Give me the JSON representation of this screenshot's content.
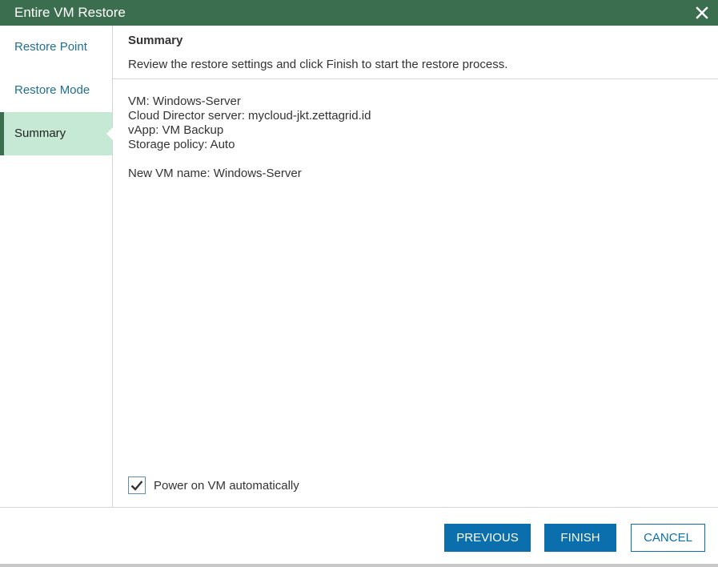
{
  "window": {
    "title": "Entire VM Restore",
    "close_icon": "close-icon"
  },
  "sidebar": {
    "items": [
      {
        "label": "Restore Point",
        "active": false
      },
      {
        "label": "Restore Mode",
        "active": false
      },
      {
        "label": "Summary",
        "active": true
      }
    ]
  },
  "main": {
    "title": "Summary",
    "description": "Review the restore settings and click Finish to start the restore process.",
    "details": {
      "vm": "VM: Windows-Server",
      "cloud_director": "Cloud Director server: mycloud-jkt.zettagrid.id",
      "vapp": "vApp: VM Backup",
      "storage_policy": "Storage policy: Auto",
      "new_vm_name": "New VM name: Windows-Server"
    },
    "power_on": {
      "label": "Power on VM automatically",
      "checked": true
    }
  },
  "footer": {
    "previous_label": "PREVIOUS",
    "finish_label": "FINISH",
    "cancel_label": "CANCEL"
  },
  "colors": {
    "titlebar": "#3b6e4f",
    "active_nav_bg": "#c6e9d6",
    "link": "#1f6f95",
    "primary_button": "#0a6fac"
  }
}
